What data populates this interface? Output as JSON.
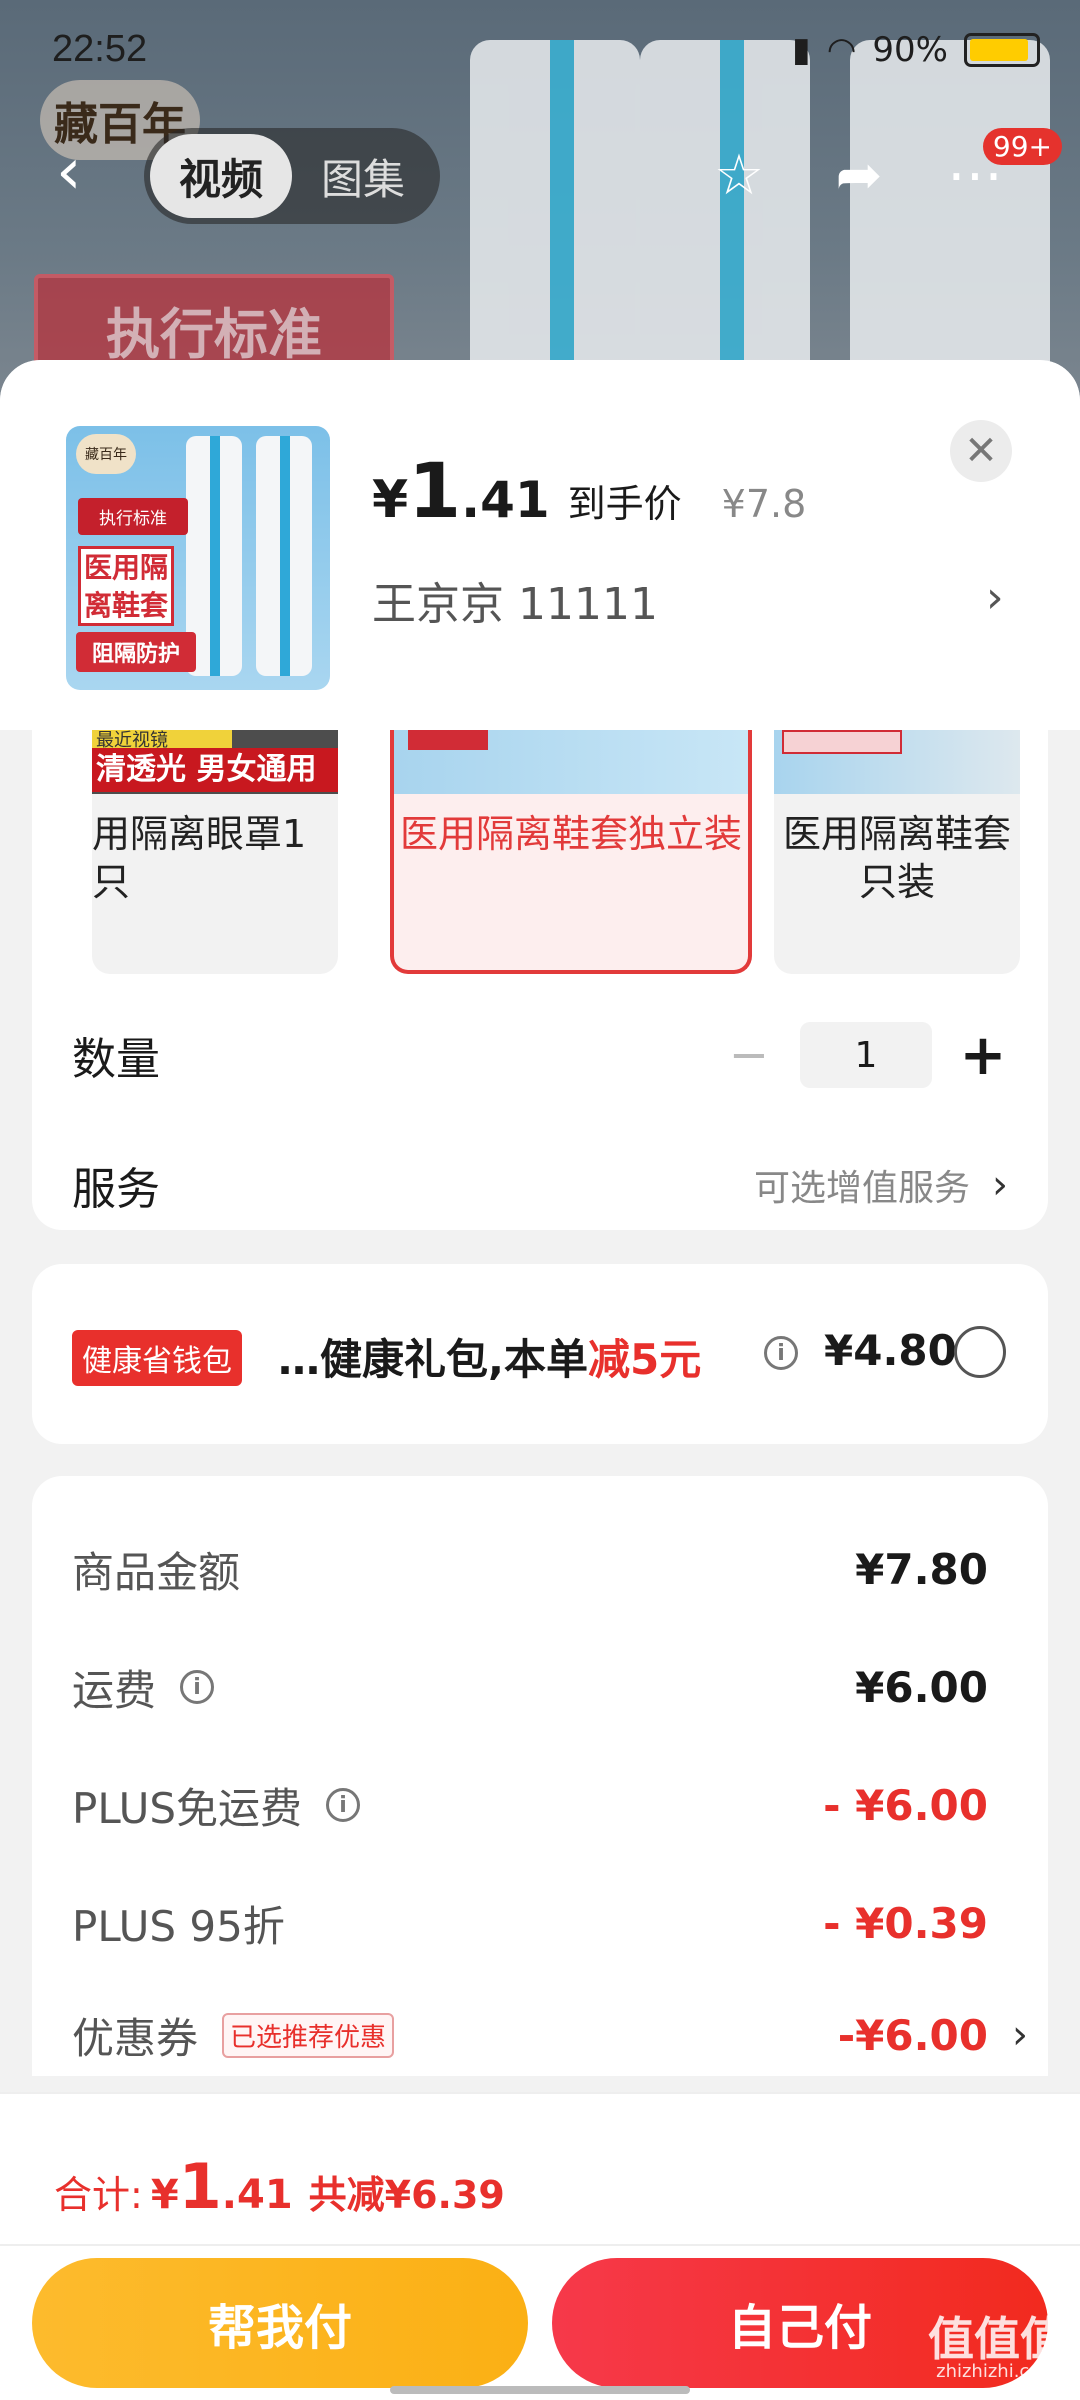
{
  "status_bar": {
    "time": "22:52",
    "battery": "90%"
  },
  "background": {
    "logo": "藏百年",
    "badge": "执行标准"
  },
  "top_nav": {
    "tabs": [
      "视频",
      "图集"
    ],
    "active_tab": 0,
    "badge": "99+"
  },
  "product": {
    "currency": "¥",
    "price_int": "1",
    "price_dec": ".41",
    "price_tag": "到手价",
    "orig_price": "¥7.8",
    "sku_text": "王京京  11111",
    "thumb": {
      "logo": "藏百年",
      "std": "执行标准",
      "med": "医用隔离鞋套",
      "prot": "阻隔防护"
    }
  },
  "variants": [
    {
      "label": "用隔离眼罩1只",
      "strip": "清透光 男女通用",
      "mini": "最近视镜",
      "selected": false
    },
    {
      "label": "医用隔离鞋套独立装",
      "selected": true
    },
    {
      "label": "医用隔离鞋套只装",
      "selected": false
    }
  ],
  "quantity": {
    "label": "数量",
    "value": "1",
    "minus": "−",
    "plus": "+"
  },
  "service": {
    "label": "服务",
    "value": "可选增值服务"
  },
  "health": {
    "badge": "健康省钱包",
    "text_pre": "…健康礼包,本单",
    "text_red": "减5元",
    "price": "¥4.80"
  },
  "summary": {
    "goods": {
      "label": "商品金额",
      "value": "¥7.80"
    },
    "shipping": {
      "label": "运费",
      "value": "¥6.00"
    },
    "plus_ship": {
      "label": "PLUS免运费",
      "value": "- ¥6.00"
    },
    "plus_disc": {
      "label": "PLUS 95折",
      "value": "- ¥0.39"
    },
    "coupon": {
      "label": "优惠券",
      "tag": "已选推荐优惠",
      "value": "-¥6.00"
    }
  },
  "footer": {
    "total_label": "合计:",
    "currency": "¥",
    "total_int": "1",
    "total_dec": ".41",
    "saved": "共减¥6.39",
    "help_pay": "帮我付",
    "self_pay": "自己付"
  },
  "watermark": {
    "main": "值值值",
    "sub": "zhizhizhi.com"
  },
  "colors": {
    "accent_red": "#e8302c",
    "help_btn": "#fbb014",
    "self_btn": "#f22a1e"
  }
}
